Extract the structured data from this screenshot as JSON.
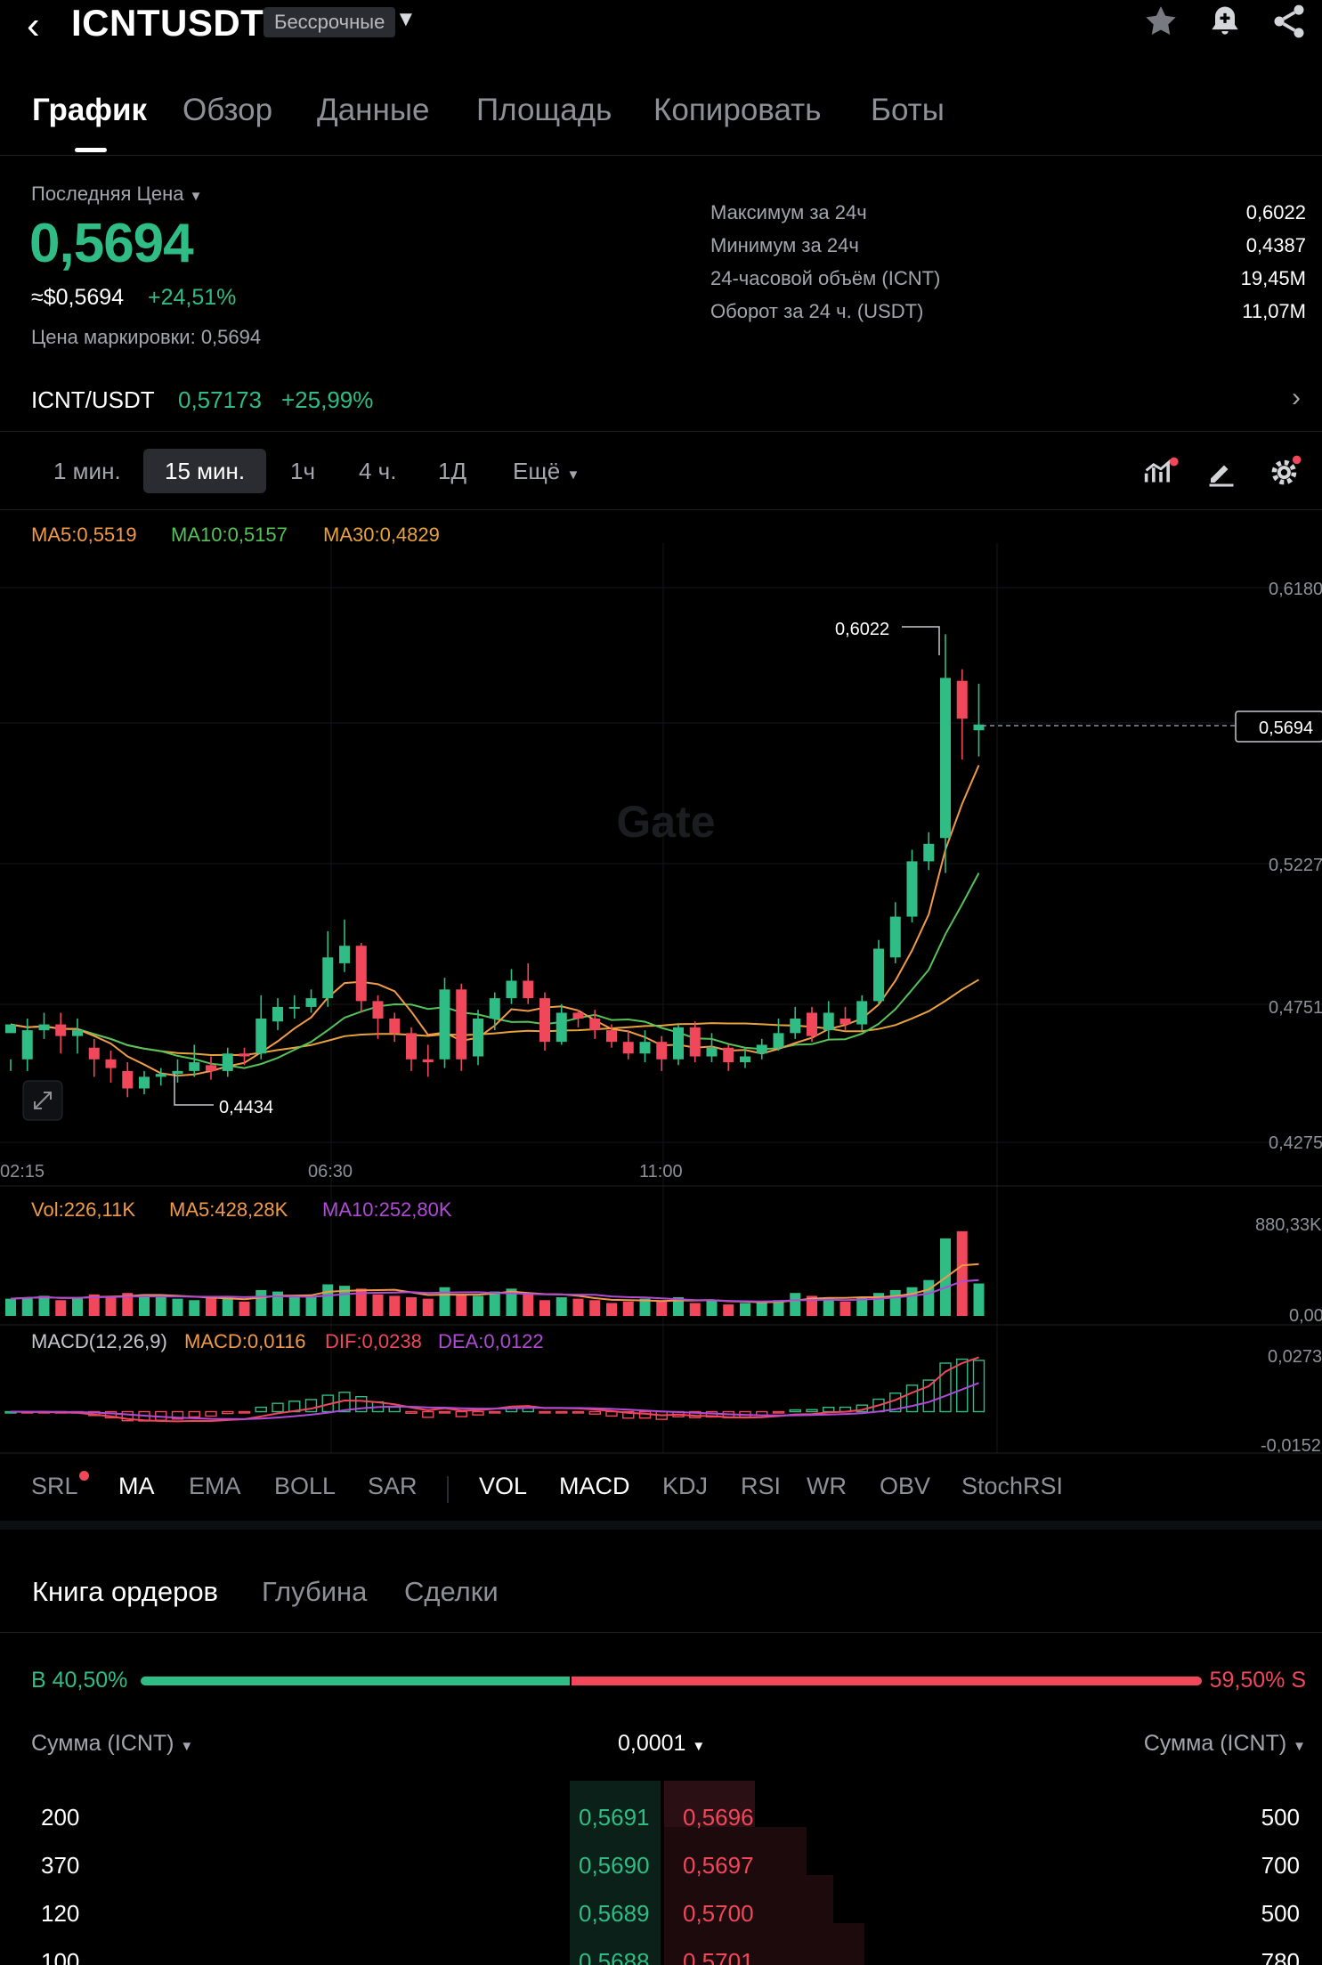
{
  "header": {
    "title": "ICNTUSDT",
    "badge": "Бессрочные"
  },
  "tabs": [
    "График",
    "Обзор",
    "Данные",
    "Площадь",
    "Копировать",
    "Боты"
  ],
  "price_block": {
    "last_price_label": "Последняя Цена",
    "last_price": "0,5694",
    "usd_price": "≈$0,5694",
    "change": "+24,51%",
    "mark_price": "Цена маркировки:  0,5694",
    "stats": [
      {
        "label": "Максимум за 24ч",
        "value": "0,6022"
      },
      {
        "label": "Минимум за 24ч",
        "value": "0,4387"
      },
      {
        "label": "24-часовой объём (ICNT)",
        "value": "19,45M"
      },
      {
        "label": "Оборот за 24 ч. (USDT)",
        "value": "11,07M"
      }
    ]
  },
  "spot": {
    "pair": "ICNT/USDT",
    "price": "0,57173",
    "change": "+25,99%"
  },
  "timeframes": [
    "1 мин.",
    "15 мин.",
    "1ч",
    "4 ч.",
    "1Д",
    "Ещё"
  ],
  "ma_legend": {
    "ma5": "MA5:0,5519",
    "ma10": "MA10:0,5157",
    "ma30": "MA30:0,4829"
  },
  "chart": {
    "watermark": "Gate",
    "high_label": "0,6022",
    "low_label": "0,4434",
    "current_price_tag": "0,5694",
    "y_ticks": [
      "0,6180",
      "0,5227",
      "0,4751",
      "0,4275"
    ],
    "x_ticks": [
      "02:15",
      "06:30",
      "11:00"
    ],
    "vol_legend": {
      "vol": "Vol:226,11K",
      "ma5": "MA5:428,28K",
      "ma10": "MA10:252,80K"
    },
    "vol_ticks": [
      "880,33K",
      "0,00"
    ],
    "macd_legend": {
      "name": "MACD(12,26,9)",
      "macd": "MACD:0,0116",
      "dif": "DIF:0,0238",
      "dea": "DEA:0,0122"
    },
    "macd_ticks": [
      "0,0273",
      "-0,0152"
    ],
    "colors": {
      "up": "#2fbd85",
      "down": "#f0475b",
      "ma5": "#f09a4a",
      "ma10": "#55c25a",
      "ma30": "#e8a33d",
      "macd_dea": "#b04bd6"
    }
  },
  "chart_data": {
    "type": "candlestick",
    "ylim": [
      0.4275,
      0.618
    ],
    "candles": [
      [
        0.465,
        0.468,
        0.456,
        0.452
      ],
      [
        0.456,
        0.466,
        0.47,
        0.452
      ],
      [
        0.466,
        0.468,
        0.472,
        0.463
      ],
      [
        0.468,
        0.464,
        0.472,
        0.458
      ],
      [
        0.464,
        0.466,
        0.47,
        0.458
      ],
      [
        0.46,
        0.456,
        0.463,
        0.45
      ],
      [
        0.456,
        0.453,
        0.459,
        0.448
      ],
      [
        0.452,
        0.446,
        0.455,
        0.443
      ],
      [
        0.446,
        0.45,
        0.452,
        0.444
      ],
      [
        0.45,
        0.451,
        0.453,
        0.447
      ],
      [
        0.451,
        0.452,
        0.456,
        0.448
      ],
      [
        0.452,
        0.455,
        0.461,
        0.45
      ],
      [
        0.454,
        0.452,
        0.457,
        0.449
      ],
      [
        0.452,
        0.458,
        0.46,
        0.45
      ],
      [
        0.458,
        0.457,
        0.46,
        0.454
      ],
      [
        0.458,
        0.47,
        0.478,
        0.456
      ],
      [
        0.469,
        0.474,
        0.477,
        0.466
      ],
      [
        0.474,
        0.474,
        0.478,
        0.47
      ],
      [
        0.474,
        0.477,
        0.48,
        0.472
      ],
      [
        0.477,
        0.491,
        0.5,
        0.474
      ],
      [
        0.489,
        0.495,
        0.504,
        0.486
      ],
      [
        0.495,
        0.476,
        0.496,
        0.472
      ],
      [
        0.476,
        0.47,
        0.478,
        0.463
      ],
      [
        0.47,
        0.465,
        0.472,
        0.462
      ],
      [
        0.465,
        0.456,
        0.467,
        0.452
      ],
      [
        0.456,
        0.455,
        0.461,
        0.45
      ],
      [
        0.456,
        0.48,
        0.484,
        0.453
      ],
      [
        0.48,
        0.456,
        0.482,
        0.452
      ],
      [
        0.457,
        0.47,
        0.473,
        0.454
      ],
      [
        0.47,
        0.477,
        0.479,
        0.466
      ],
      [
        0.477,
        0.483,
        0.487,
        0.475
      ],
      [
        0.483,
        0.477,
        0.489,
        0.475
      ],
      [
        0.477,
        0.462,
        0.479,
        0.459
      ],
      [
        0.462,
        0.472,
        0.475,
        0.461
      ],
      [
        0.472,
        0.47,
        0.473,
        0.467
      ],
      [
        0.47,
        0.466,
        0.473,
        0.463
      ],
      [
        0.466,
        0.462,
        0.468,
        0.46
      ],
      [
        0.462,
        0.458,
        0.466,
        0.456
      ],
      [
        0.458,
        0.462,
        0.466,
        0.455
      ],
      [
        0.462,
        0.456,
        0.464,
        0.452
      ],
      [
        0.456,
        0.467,
        0.468,
        0.454
      ],
      [
        0.467,
        0.457,
        0.469,
        0.455
      ],
      [
        0.457,
        0.46,
        0.465,
        0.455
      ],
      [
        0.46,
        0.455,
        0.461,
        0.452
      ],
      [
        0.455,
        0.457,
        0.46,
        0.453
      ],
      [
        0.458,
        0.461,
        0.463,
        0.456
      ],
      [
        0.46,
        0.465,
        0.47,
        0.459
      ],
      [
        0.465,
        0.47,
        0.474,
        0.463
      ],
      [
        0.472,
        0.464,
        0.474,
        0.462
      ],
      [
        0.466,
        0.472,
        0.476,
        0.463
      ],
      [
        0.47,
        0.468,
        0.474,
        0.466
      ],
      [
        0.468,
        0.476,
        0.478,
        0.466
      ],
      [
        0.476,
        0.494,
        0.497,
        0.475
      ],
      [
        0.491,
        0.505,
        0.51,
        0.489
      ],
      [
        0.505,
        0.524,
        0.528,
        0.503
      ],
      [
        0.524,
        0.53,
        0.534,
        0.521
      ],
      [
        0.532,
        0.587,
        0.602,
        0.52
      ],
      [
        0.586,
        0.573,
        0.59,
        0.559
      ],
      [
        0.569,
        0.571,
        0.585,
        0.56
      ]
    ],
    "volume_ylim": [
      0,
      880330
    ],
    "volume": [
      120,
      130,
      140,
      110,
      130,
      150,
      140,
      160,
      150,
      130,
      120,
      110,
      130,
      120,
      100,
      180,
      170,
      140,
      130,
      220,
      210,
      190,
      150,
      140,
      130,
      120,
      200,
      150,
      140,
      170,
      190,
      150,
      110,
      130,
      120,
      110,
      90,
      100,
      120,
      100,
      130,
      90,
      110,
      80,
      90,
      100,
      110,
      160,
      140,
      120,
      100,
      130,
      160,
      180,
      200,
      250,
      540,
      590,
      226.11
    ],
    "macd_ylim": [
      -0.0152,
      0.0273
    ]
  }
}
